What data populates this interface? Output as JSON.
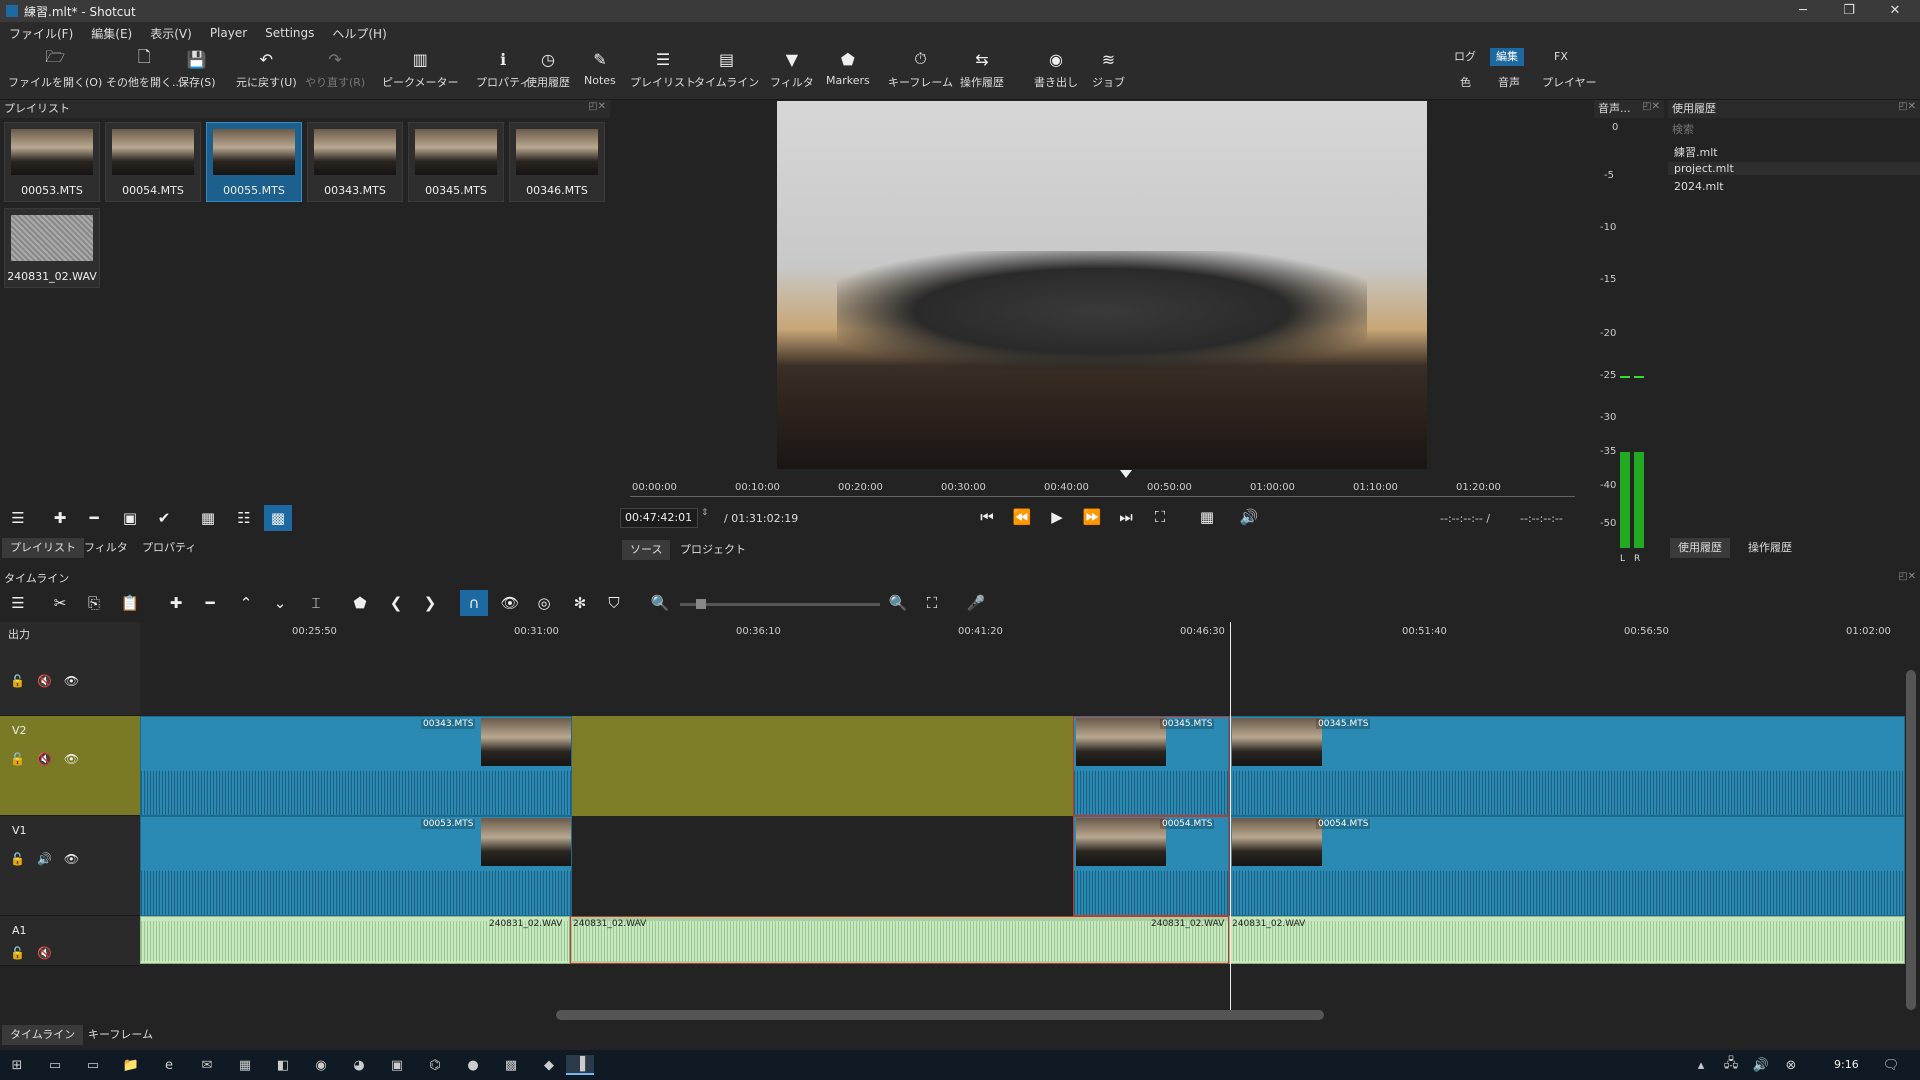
{
  "window": {
    "title": "練習.mlt* - Shotcut",
    "controls": [
      "─",
      "❐",
      "✕"
    ]
  },
  "menu": [
    "ファイル(F)",
    "編集(E)",
    "表示(V)",
    "Player",
    "Settings",
    "ヘルプ(H)"
  ],
  "toolbar": [
    {
      "label": "ファイルを開く(O)",
      "icon": "folder-open-icon",
      "glyph": "🗁"
    },
    {
      "label": "その他を開く...",
      "icon": "open-other-icon",
      "glyph": "🗋"
    },
    {
      "label": "保存(S)",
      "icon": "save-icon",
      "glyph": "💾"
    },
    {
      "label": "元に戻す(U)",
      "icon": "undo-icon",
      "glyph": "↶"
    },
    {
      "label": "やり直す(R)",
      "icon": "redo-icon",
      "glyph": "↷",
      "disabled": true
    },
    {
      "label": "ピークメーター",
      "icon": "peak-meter-icon",
      "glyph": "▥"
    },
    {
      "label": "プロパティ",
      "icon": "properties-icon",
      "glyph": "ℹ"
    },
    {
      "label": "使用履歴",
      "icon": "recent-icon",
      "glyph": "◷"
    },
    {
      "label": "Notes",
      "icon": "notes-icon",
      "glyph": "✎"
    },
    {
      "label": "プレイリスト",
      "icon": "playlist-icon",
      "glyph": "☰"
    },
    {
      "label": "タイムライン",
      "icon": "timeline-icon",
      "glyph": "▤"
    },
    {
      "label": "フィルタ",
      "icon": "filter-icon",
      "glyph": "▼"
    },
    {
      "label": "Markers",
      "icon": "markers-icon",
      "glyph": "⬟"
    },
    {
      "label": "キーフレーム",
      "icon": "keyframes-icon",
      "glyph": "⏱"
    },
    {
      "label": "操作履歴",
      "icon": "history-icon",
      "glyph": "⇆"
    },
    {
      "label": "書き出し",
      "icon": "export-icon",
      "glyph": "◉"
    },
    {
      "label": "ジョブ",
      "icon": "jobs-icon",
      "glyph": "≋"
    }
  ],
  "workspaces": {
    "row1": [
      "ログ",
      "編集",
      "FX"
    ],
    "row2": [
      "色",
      "音声",
      "プレイヤー"
    ],
    "active": "編集"
  },
  "playlist": {
    "title": "プレイリスト",
    "items": [
      "00053.MTS",
      "00054.MTS",
      "00055.MTS",
      "00343.MTS",
      "00345.MTS",
      "00346.MTS",
      "240831_02.WAV"
    ],
    "selected": "00055.MTS",
    "tabs": [
      "プレイリスト",
      "フィルタ",
      "プロパティ"
    ]
  },
  "viewer": {
    "ruler": [
      "00:00:00",
      "00:10:00",
      "00:20:00",
      "00:30:00",
      "00:40:00",
      "00:50:00",
      "01:00:00",
      "01:10:00",
      "01:20:00"
    ],
    "position": "00:47:42:01",
    "duration": "/ 01:31:02:19",
    "in_out": "--:--:--:-- /",
    "in_out2": "--:--:--:--",
    "tabs": [
      "ソース",
      "プロジェクト"
    ]
  },
  "meters": {
    "title": "音声...",
    "ticks": [
      "0",
      "-5",
      "-10",
      "-15",
      "-20",
      "-25",
      "-30",
      "-35",
      "-40",
      "-50"
    ],
    "channels": [
      "L",
      "R"
    ],
    "level_db": -35,
    "peak_db": -25,
    "color": "#22aa22"
  },
  "recent": {
    "title": "使用履歴",
    "search_placeholder": "検索",
    "items": [
      "練習.mlt",
      "project.mlt",
      "2024.mlt"
    ],
    "tabs": [
      "使用履歴",
      "操作履歴"
    ]
  },
  "timeline": {
    "title": "タイムライン",
    "output_label": "出力",
    "ruler": [
      "00:25:50",
      "00:31:00",
      "00:36:10",
      "00:41:20",
      "00:46:30",
      "00:51:40",
      "00:56:50",
      "01:02:00"
    ],
    "tracks": [
      {
        "name": "V2",
        "clips": [
          "00343.MTS",
          "00345.MTS",
          "00345.MTS"
        ]
      },
      {
        "name": "V1",
        "clips": [
          "00053.MTS",
          "00054.MTS",
          "00054.MTS"
        ]
      },
      {
        "name": "A1",
        "clips": [
          "240831_02.WAV",
          "240831_02.WAV",
          "240831_02.WAV",
          "240831_02.WAV"
        ]
      }
    ],
    "tabs": [
      "タイムライン",
      "キーフレーム"
    ]
  },
  "taskbar": {
    "clock": "9:16"
  },
  "colors": {
    "accent": "#1d6aa3",
    "clip": "#2a8ab3",
    "audio_clip": "#c8e8c0",
    "selected_track": "#7a7a26",
    "gap": "#7d7d28"
  }
}
